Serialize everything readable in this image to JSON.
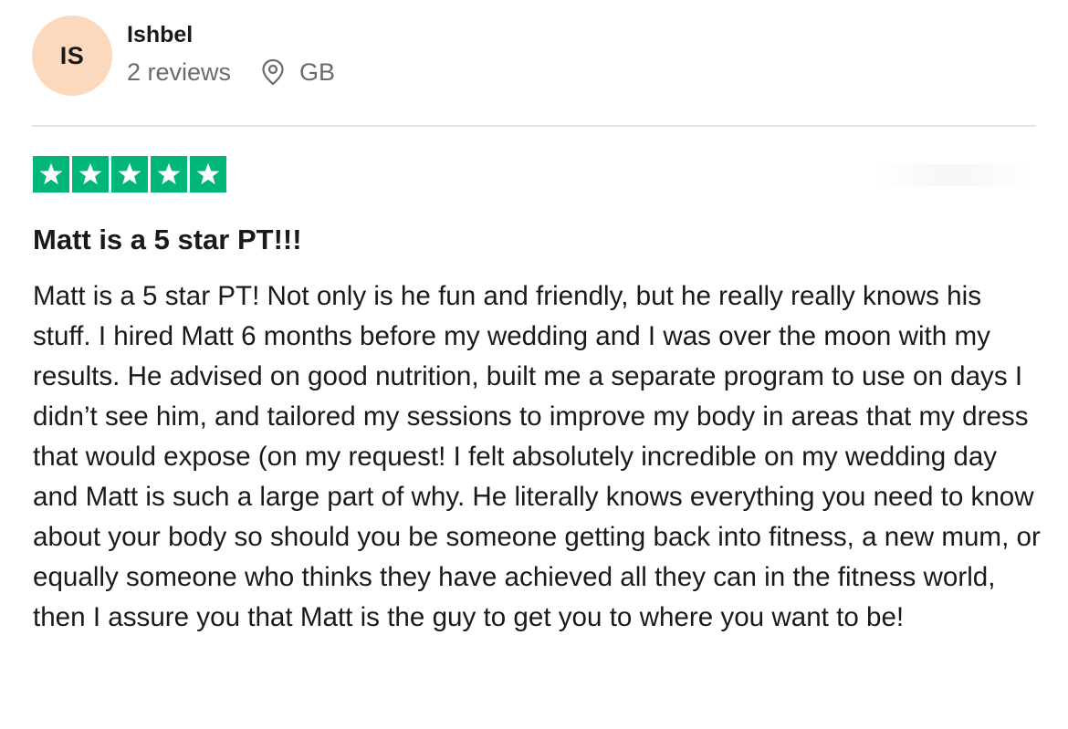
{
  "reviewer": {
    "initials": "IS",
    "name": "Ishbel",
    "review_count": "2 reviews",
    "country": "GB",
    "avatar_color": "#fcd9bd"
  },
  "review": {
    "rating": 5,
    "rating_max": 5,
    "star_color": "#00b67a",
    "title": "Matt is a 5 star PT!!!",
    "body": "Matt is a 5 star PT! Not only is he fun and friendly, but he really really knows his stuff. I hired Matt 6 months before my wedding and I was over the moon with my results. He advised on good nutrition, built me a separate program to use on days I didn’t see him, and tailored my sessions to improve my body in areas that my dress that would expose (on my request! I felt absolutely incredible on my wedding day and Matt is such a large part of why. He literally knows everything you need to know about your body so should you be someone getting back into fitness, a new mum, or equally someone who thinks they have achieved all they can in the fitness world, then I assure you that Matt is the guy to get you to where you want to be!"
  },
  "icons": {
    "location": "map-pin-icon",
    "star": "star-icon"
  }
}
